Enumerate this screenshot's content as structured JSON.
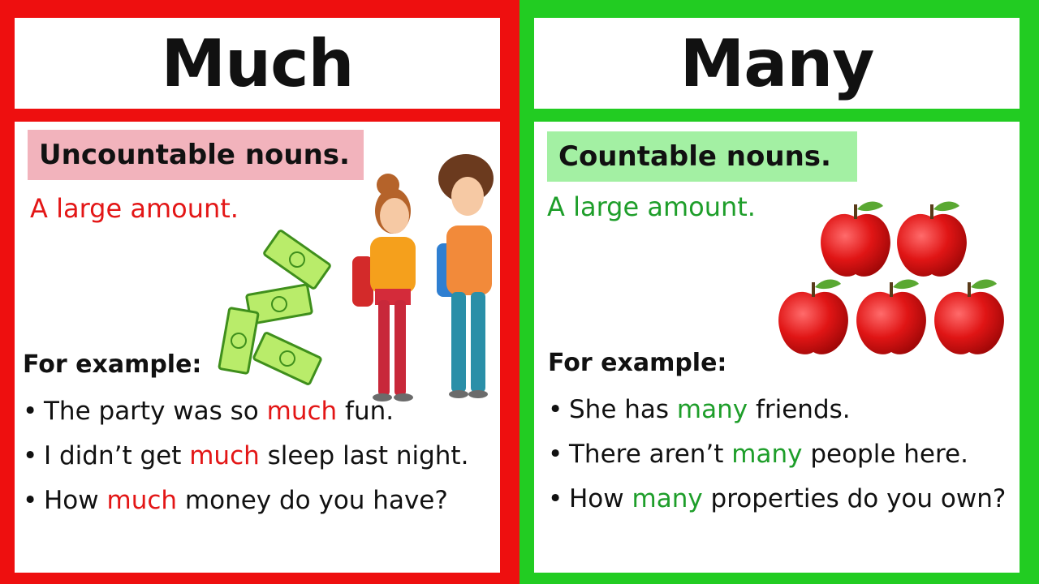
{
  "left": {
    "title": "Much",
    "label": "Uncountable nouns.",
    "subtitle": "A large amount.",
    "example_heading": "For example:",
    "examples": [
      {
        "before": "The party was so ",
        "highlight": "much",
        "after": " fun."
      },
      {
        "before": "I didn’t get ",
        "highlight": "much",
        "after": " sleep last night."
      },
      {
        "before": "How ",
        "highlight": "much",
        "after": " money do you have?"
      }
    ],
    "colors": {
      "frame": "#ee0f0f",
      "label_bg": "#f2b3bc",
      "accent": "#e31616"
    },
    "illustration": "students-with-money"
  },
  "right": {
    "title": "Many",
    "label": "Countable nouns.",
    "subtitle": "A large amount.",
    "example_heading": "For example:",
    "examples": [
      {
        "before": "She has ",
        "highlight": "many",
        "after": " friends."
      },
      {
        "before": "There aren’t ",
        "highlight": "many",
        "after": " people here."
      },
      {
        "before": "How ",
        "highlight": "many",
        "after": " properties do you own?"
      }
    ],
    "colors": {
      "frame": "#22cc22",
      "label_bg": "#a3f0a3",
      "accent": "#1e9e2a"
    },
    "illustration": "apple-pyramid"
  },
  "bullet": "•"
}
